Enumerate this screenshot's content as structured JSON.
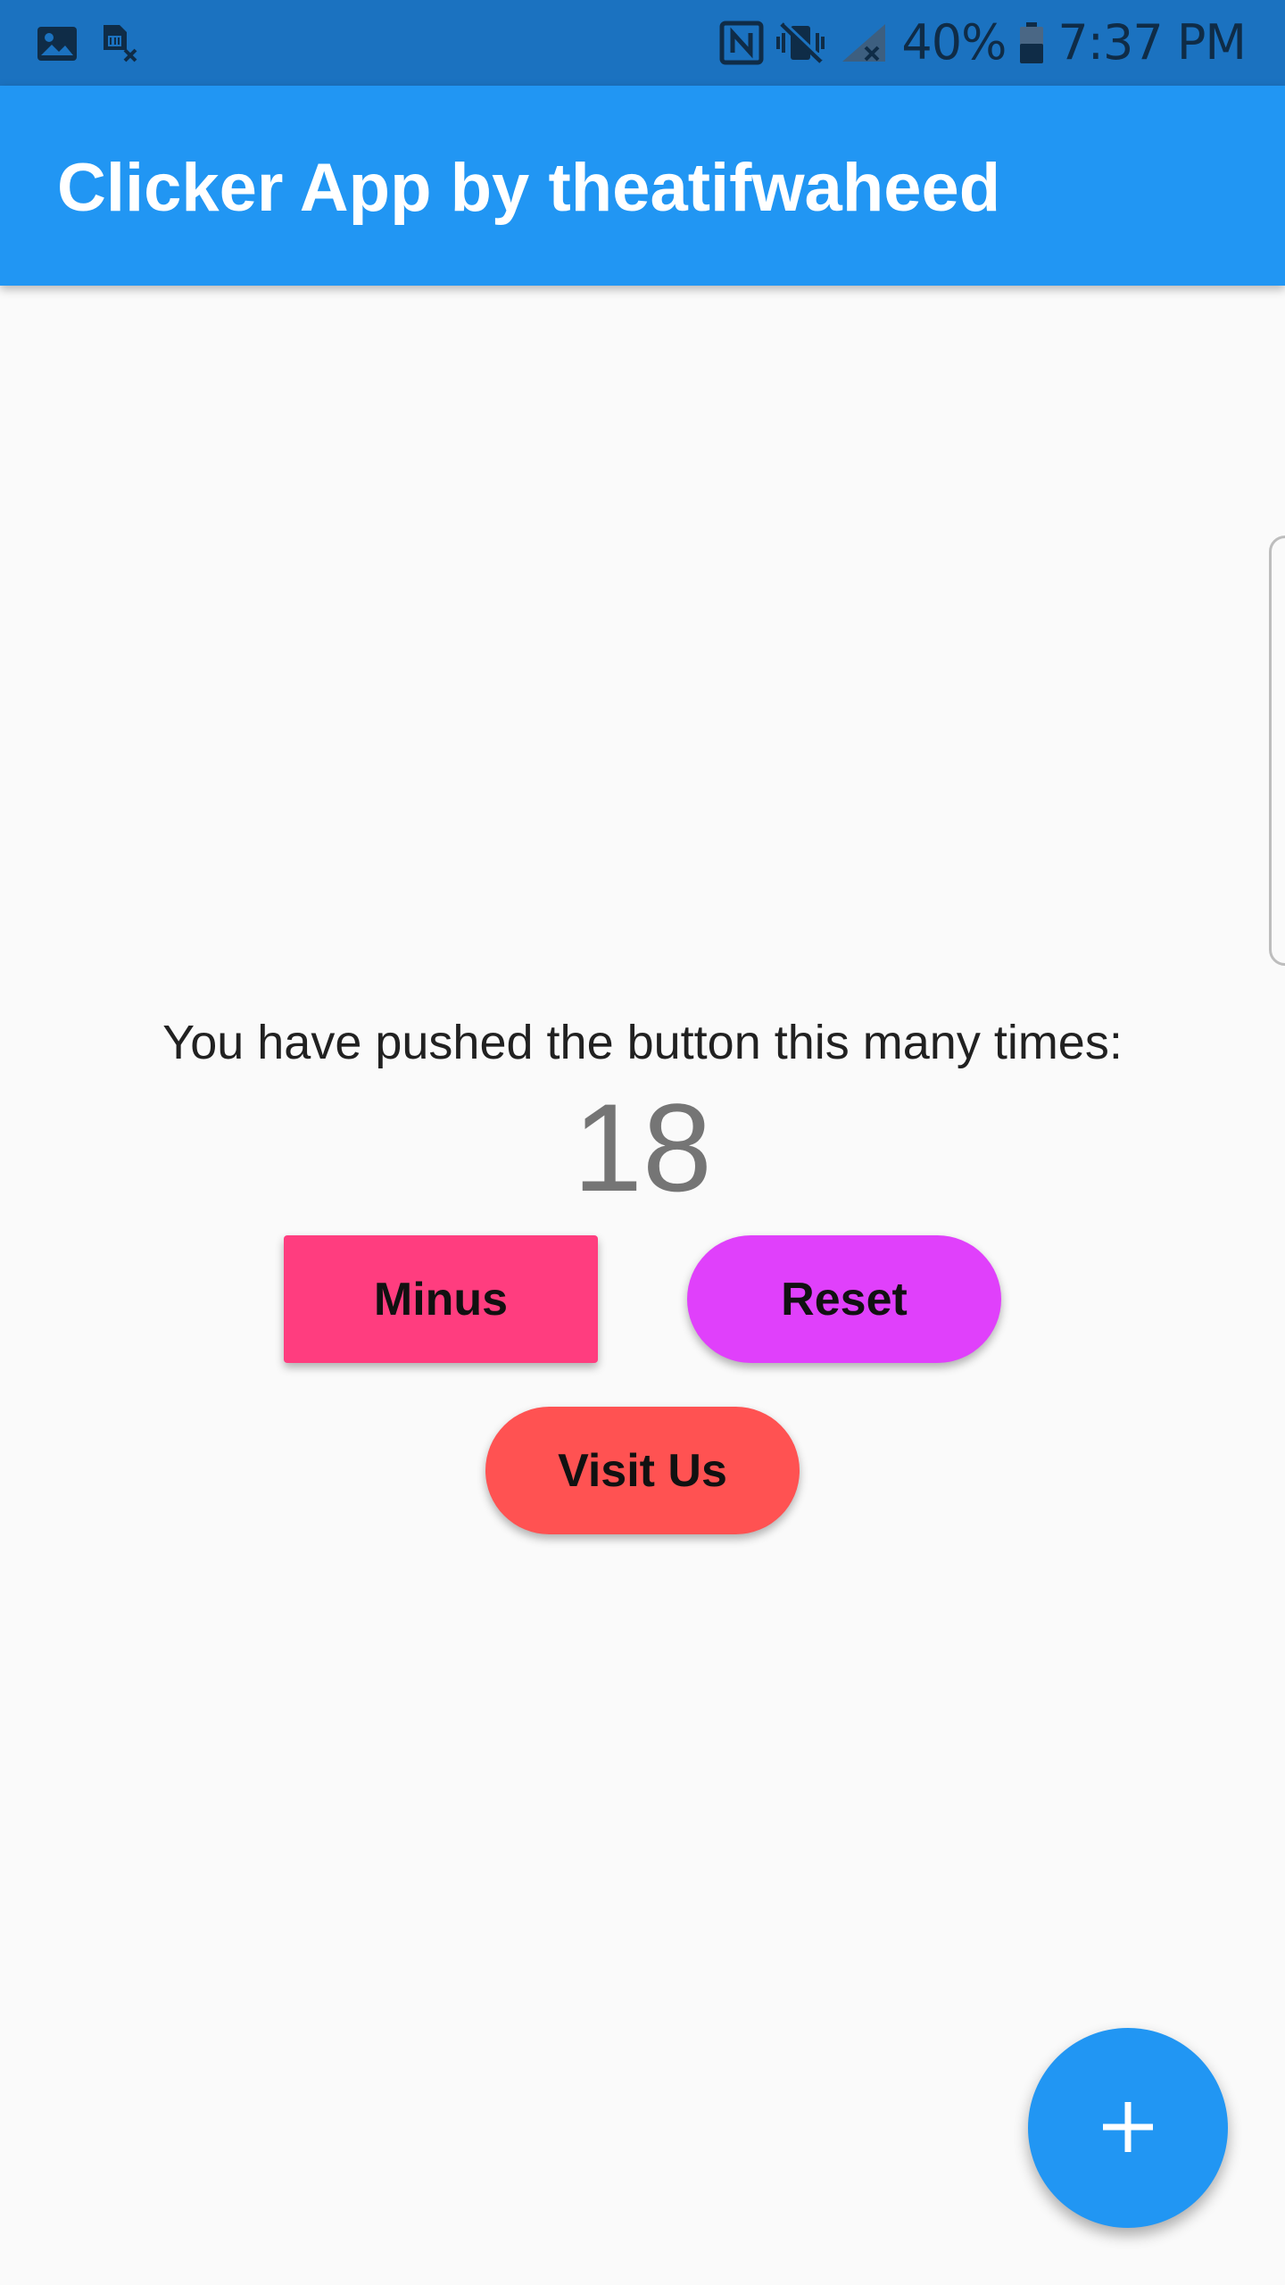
{
  "status_bar": {
    "icons_left": [
      "gallery-icon",
      "sim-card-x-icon"
    ],
    "icons_right": [
      "nfc-icon",
      "vibrate-mute-icon",
      "signal-no-service-icon",
      "battery-icon"
    ],
    "battery": "40%",
    "time": "7:37 PM"
  },
  "app_bar": {
    "title": "Clicker App by theatifwaheed"
  },
  "main": {
    "prompt": "You have pushed the button this many times:",
    "counter": "18"
  },
  "buttons": {
    "minus_label": "Minus",
    "reset_label": "Reset",
    "visit_label": "Visit Us"
  },
  "fab": {
    "icon": "plus-icon"
  },
  "colors": {
    "status_bar": "#1b72c0",
    "app_bar": "#2196f3",
    "background": "#fafafa",
    "minus_button": "#ff3d7f",
    "reset_button": "#e040fb",
    "visit_button": "#ff5252",
    "fab": "#2196f3"
  }
}
